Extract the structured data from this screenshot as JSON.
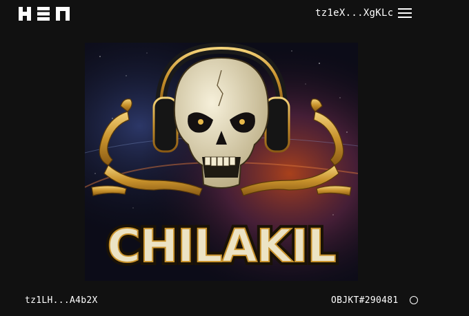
{
  "header": {
    "logo_icon": "hen-logo-icon",
    "wallet_address": "tz1eX...XgKLc",
    "menu_icon": "hamburger-menu-icon"
  },
  "artwork": {
    "logo_text": "CHILAKIL",
    "icons": [
      "skull-icon",
      "headphones-icon",
      "scorpion-icon"
    ]
  },
  "footer": {
    "creator_address": "tz1LH...A4b2X",
    "objkt_id": "OBJKT#290481",
    "status_icon": "circle-icon"
  },
  "colors": {
    "background": "#111111",
    "text": "#ffffff",
    "gold": "#d9a93c",
    "bone": "#ece3c4"
  }
}
